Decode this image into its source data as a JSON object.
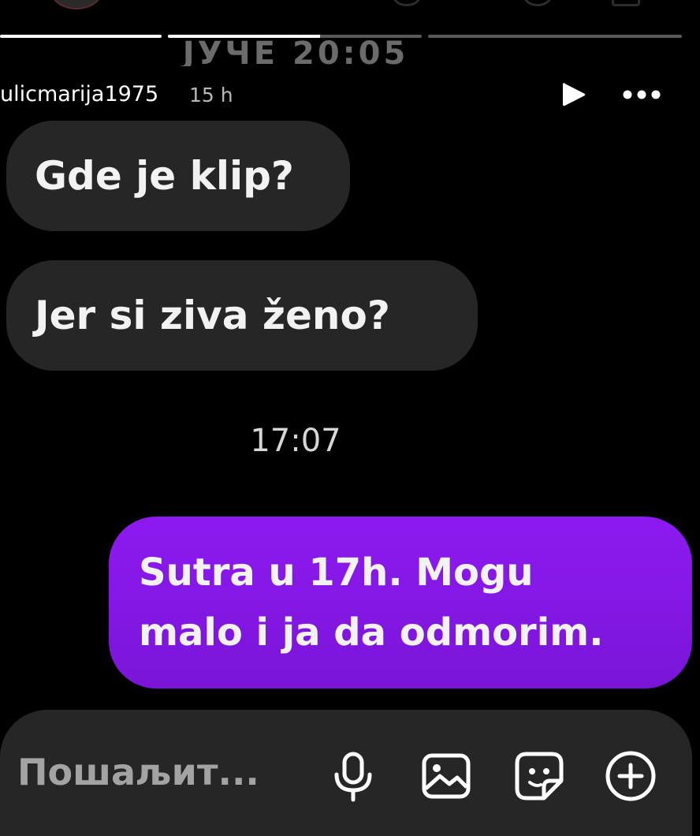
{
  "header": {
    "ghost_date": "ЈУЧЕ 20:05",
    "username": "ulicmarija1975",
    "time_ago": "15 h",
    "progress_segments": [
      1.0,
      0.6,
      0.0
    ]
  },
  "messages": [
    {
      "direction": "incoming",
      "text": "Gde je klip?"
    },
    {
      "direction": "incoming",
      "text": "Jer si ziva ženo?"
    },
    {
      "direction": "outgoing",
      "text": "Sutra u 17h. Mogu\nmalo i ja da odmorim."
    }
  ],
  "timestamp": "17:07",
  "composer": {
    "placeholder": "Пошаљит...",
    "icons": [
      "microphone-icon",
      "image-icon",
      "sticker-icon",
      "add-icon"
    ]
  },
  "colors": {
    "background": "#000000",
    "incoming_bubble": "#262626",
    "outgoing_bubble": "#8d1af0",
    "composer": "#262626"
  }
}
